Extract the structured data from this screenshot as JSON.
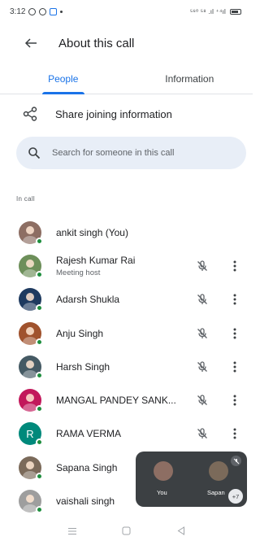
{
  "status_bar": {
    "time": "3:12",
    "right_text": "⁵⁶⁰ ⁵⁸ .ıl ⁺⁴ıl"
  },
  "app_bar": {
    "back_icon": "arrow-back-icon",
    "title": "About this call"
  },
  "tabs": [
    {
      "label": "People",
      "active": true
    },
    {
      "label": "Information",
      "active": false
    }
  ],
  "share": {
    "icon": "share-icon",
    "label": "Share joining information"
  },
  "search": {
    "icon": "search-icon",
    "placeholder": "Search for someone in this call"
  },
  "section_label": "In call",
  "participants": [
    {
      "name": "ankit singh (You)",
      "subtitle": "",
      "online": true,
      "avatar_color": "#8d6e63",
      "avatar_letter": "",
      "muted_icon": false,
      "more": false
    },
    {
      "name": "Rajesh Kumar Rai",
      "subtitle": "Meeting host",
      "online": true,
      "avatar_color": "#6d8f5a",
      "avatar_letter": "",
      "muted_icon": true,
      "more": true
    },
    {
      "name": "Adarsh Shukla",
      "subtitle": "",
      "online": true,
      "avatar_color": "#1e3a5f",
      "avatar_letter": "",
      "muted_icon": true,
      "more": true
    },
    {
      "name": "Anju Singh",
      "subtitle": "",
      "online": true,
      "avatar_color": "#a0522d",
      "avatar_letter": "",
      "muted_icon": true,
      "more": true
    },
    {
      "name": "Harsh Singh",
      "subtitle": "",
      "online": true,
      "avatar_color": "#455a64",
      "avatar_letter": "",
      "muted_icon": true,
      "more": true
    },
    {
      "name": "MANGAL PANDEY SANK...",
      "subtitle": "",
      "online": true,
      "avatar_color": "#c2185b",
      "avatar_letter": "",
      "muted_icon": true,
      "more": true
    },
    {
      "name": "RAMA VERMA",
      "subtitle": "",
      "online": true,
      "avatar_color": "#00897b",
      "avatar_letter": "R",
      "muted_icon": true,
      "more": true
    },
    {
      "name": "Sapana Singh",
      "subtitle": "",
      "online": true,
      "avatar_color": "#7b6a5a",
      "avatar_letter": "",
      "muted_icon": false,
      "more": false
    },
    {
      "name": "vaishali singh",
      "subtitle": "",
      "online": true,
      "avatar_color": "#9e9e9e",
      "avatar_letter": "",
      "muted_icon": false,
      "more": false
    }
  ],
  "pip": {
    "tiles": [
      {
        "name": "You",
        "color": "#8d6e63"
      },
      {
        "name": "Sapan",
        "color": "#7b6a5a"
      }
    ],
    "more_count": "+7"
  },
  "colors": {
    "accent": "#1a73e8",
    "online": "#1e8e3e",
    "search_bg": "#e8eef7",
    "pip_bg": "#3c4043"
  }
}
